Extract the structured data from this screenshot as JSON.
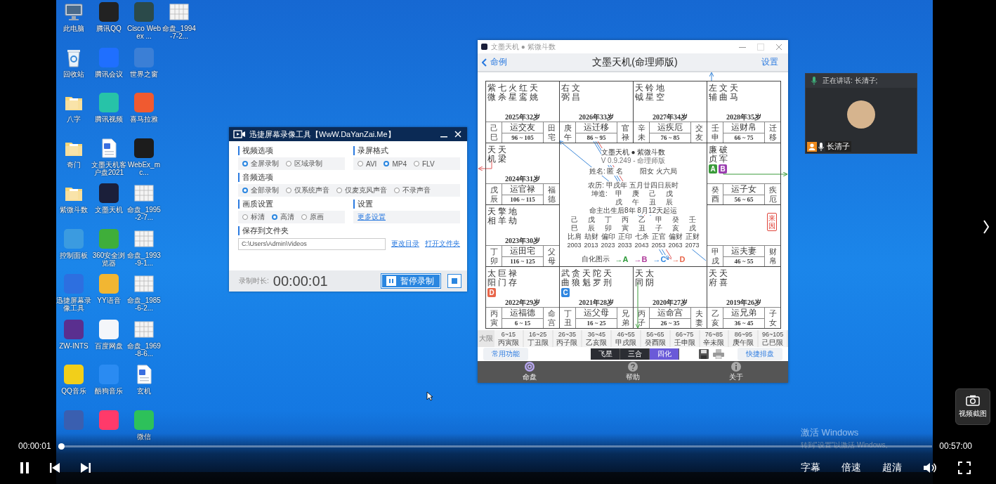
{
  "desktop": {
    "columns": [
      [
        {
          "label": "此电脑",
          "kind": "computer"
        },
        {
          "label": "回收站",
          "kind": "recycle"
        },
        {
          "label": "八字",
          "kind": "folder"
        },
        {
          "label": "奇门",
          "kind": "folder"
        },
        {
          "label": "紫微斗数",
          "kind": "folder"
        },
        {
          "label": "控制面板",
          "kind": "app",
          "color": "#3b9be0"
        },
        {
          "label": "迅捷屏幕录像工具",
          "kind": "app",
          "color": "#2d6fe0"
        },
        {
          "label": "ZW-INTS",
          "kind": "app",
          "color": "#5a2f8f"
        },
        {
          "label": "QQ音乐",
          "kind": "app",
          "color": "#f2cf1a"
        },
        {
          "kind": "app",
          "color": "#3a5fb0"
        }
      ],
      [
        {
          "label": "腾讯QQ",
          "kind": "app",
          "color": "#222222"
        },
        {
          "label": "腾讯会议",
          "kind": "app",
          "color": "#1f6fff"
        },
        {
          "label": "腾讯视频",
          "kind": "app",
          "color": "#27c3a8"
        },
        {
          "label": "文墨天机客户盘2021",
          "kind": "document"
        },
        {
          "label": "文墨天机",
          "kind": "app",
          "color": "#1b1f3a"
        },
        {
          "label": "360安全浏览器",
          "kind": "app",
          "color": "#3fae3a"
        },
        {
          "label": "YY语音",
          "kind": "app",
          "color": "#f2b632"
        },
        {
          "label": "百度网盘",
          "kind": "app",
          "color": "#f4f6fa"
        },
        {
          "label": "酷狗音乐",
          "kind": "app",
          "color": "#2a8bf2"
        },
        {
          "kind": "app",
          "color": "#ff3a6a"
        }
      ],
      [
        {
          "label": "Cisco Webex ...",
          "kind": "app",
          "color": "#2b4a4a"
        },
        {
          "label": "世界之窗",
          "kind": "app",
          "color": "#3b7fd6"
        },
        {
          "label": "喜马拉雅",
          "kind": "app",
          "color": "#f05a30"
        },
        {
          "label": "WebEx_mc...",
          "kind": "app",
          "color": "#1c1c1c"
        },
        {
          "label": "命盘_1995-2-7...",
          "kind": "image"
        },
        {
          "label": "命盘_1993-9-1...",
          "kind": "image"
        },
        {
          "label": "命盘_1985-6-2...",
          "kind": "image"
        },
        {
          "label": "命盘_1969-8-6...",
          "kind": "image"
        },
        {
          "label": "玄机",
          "kind": "document"
        },
        {
          "label": "微信",
          "kind": "app",
          "color": "#2dc15a"
        }
      ],
      [
        {
          "label": "命盘_1994-7-2...",
          "kind": "image"
        }
      ]
    ],
    "activation": {
      "title": "激活 Windows",
      "text": "转到\"设置\"以激活 Windows。"
    }
  },
  "recorder": {
    "title": "迅捷屏幕录像工具【WwW.DaYanZai.Me】",
    "groups": [
      {
        "label": "视频选项",
        "kind": "radio",
        "wide": false,
        "options": [
          {
            "label": "全屏录制",
            "selected": true
          },
          {
            "label": "区域录制",
            "selected": false
          }
        ]
      },
      {
        "label": "录屏格式",
        "kind": "radio",
        "wide": false,
        "options": [
          {
            "label": "AVI",
            "selected": false
          },
          {
            "label": "MP4",
            "selected": true
          },
          {
            "label": "FLV",
            "selected": false
          }
        ]
      },
      {
        "label": "音频选项",
        "kind": "radio",
        "wide": true,
        "options": [
          {
            "label": "全部录制",
            "selected": true
          },
          {
            "label": "仅系统声音",
            "selected": false
          },
          {
            "label": "仅麦克风声音",
            "selected": false
          },
          {
            "label": "不录声音",
            "selected": false
          }
        ]
      },
      {
        "label": "画质设置",
        "kind": "radio",
        "wide": false,
        "options": [
          {
            "label": "标清",
            "selected": false
          },
          {
            "label": "高清",
            "selected": true
          },
          {
            "label": "原画",
            "selected": false
          }
        ]
      },
      {
        "label": "设置",
        "kind": "link",
        "wide": false,
        "links": [
          "更多设置"
        ]
      },
      {
        "label": "保存到文件夹",
        "kind": "folder",
        "wide": true,
        "value": "C:\\Users\\Admin\\Videos",
        "links": [
          "更改目录",
          "打开文件夹"
        ]
      }
    ],
    "duration_label": "录制时长:",
    "duration": "00:00:01",
    "pause": "暂停录制"
  },
  "chart_app": {
    "window_title": "文墨天机 ● 紫微斗数",
    "back": "命例",
    "title": "文墨天机(命理师版)",
    "settings": "设置",
    "palaces": [
      {
        "stars": [
          "紫微",
          "七杀",
          "火星",
          "红鸾",
          "天姚"
        ],
        "year": "2025年32岁",
        "stem_branch": "己巳",
        "period": "运交友",
        "range": "96 ~ 105",
        "palace": "田宅"
      },
      {
        "stars": [
          "右弼",
          "文昌"
        ],
        "year": "2026年33岁",
        "stem_branch": "庚午",
        "period": "运迁移",
        "range": "86 ~ 95",
        "palace": "官禄"
      },
      {
        "stars": [
          "天钺",
          "铃星",
          "地空"
        ],
        "year": "2027年34岁",
        "stem_branch": "辛未",
        "period": "运疾厄",
        "range": "76 ~ 85",
        "palace": "交友"
      },
      {
        "stars": [
          "左辅",
          "文曲",
          "天马"
        ],
        "year": "2028年35岁",
        "stem_branch": "壬申",
        "period": "运财帛",
        "range": "66 ~ 75",
        "palace": "迁移"
      },
      {
        "stars": [
          "天机",
          "天梁"
        ],
        "year": "2024年31岁",
        "stem_branch": "戊辰",
        "period": "运官禄",
        "range": "106 ~ 115",
        "palace": "福德"
      },
      {
        "stars": [
          "廉贞",
          "破军"
        ],
        "badges": [
          {
            "label": "A",
            "color": "#3a9a3a"
          },
          {
            "label": "B",
            "color": "#9b3fb0"
          }
        ],
        "stem_branch": "癸酉",
        "period": "运子女",
        "range": "56 ~ 65",
        "palace": "疾厄"
      },
      {
        "stars": [
          "天相",
          "擎羊",
          "地劫"
        ],
        "year": "2023年30岁",
        "stem_branch": "丁卯",
        "period": "运田宅",
        "range": "116 ~ 125",
        "palace": "父母"
      },
      {
        "marker": "来因",
        "stem_branch": "甲戌",
        "period": "运夫妻",
        "range": "46 ~ 55",
        "palace": "财帛"
      },
      {
        "stars": [
          "太阳",
          "巨门",
          "禄存"
        ],
        "badges": [
          {
            "label": "D",
            "color": "#e8664a"
          }
        ],
        "year": "2022年29岁",
        "stem_branch": "丙寅",
        "period": "运福德",
        "range": "6 ~ 15",
        "palace": "命宫"
      },
      {
        "stars": [
          "武曲",
          "贪狼",
          "天魁",
          "陀罗",
          "天刑"
        ],
        "badges": [
          {
            "label": "C",
            "color": "#2f86e0"
          }
        ],
        "year": "2021年28岁",
        "stem_branch": "丁丑",
        "period": "运父母",
        "range": "16 ~ 25",
        "palace": "兄弟"
      },
      {
        "stars": [
          "天同",
          "太阴"
        ],
        "year": "2020年27岁",
        "stem_branch": "丙子",
        "period": "运命宫",
        "range": "26 ~ 35",
        "palace": "夫妻"
      },
      {
        "stars": [
          "天府",
          "天喜"
        ],
        "year": "2019年26岁",
        "stem_branch": "乙亥",
        "period": "运兄弟",
        "range": "36 ~ 45",
        "palace": "子女"
      }
    ],
    "center": {
      "title": "文墨天机 ● 紫微斗数",
      "version": "V 0.9.249 - 命理师版",
      "name": "姓名: 匿 名",
      "gender_bureau": "阳女 火六局",
      "lunar": "农历: 甲戌年 五月廿四日辰时",
      "pillars_label": "坤造:",
      "pillars_top": [
        "甲",
        "庚",
        "己",
        "戊"
      ],
      "pillars_bottom": [
        "戌",
        "午",
        "丑",
        "辰"
      ],
      "luck_start": "命主出生后8年 8月12天起运",
      "luck": [
        {
          "stem": "己",
          "branch": "巳",
          "god": "比肩",
          "year": "2003"
        },
        {
          "stem": "戊",
          "branch": "辰",
          "god": "劫财",
          "year": "2013"
        },
        {
          "stem": "丁",
          "branch": "卯",
          "god": "偏印",
          "year": "2023"
        },
        {
          "stem": "丙",
          "branch": "寅",
          "god": "正印",
          "year": "2033"
        },
        {
          "stem": "乙",
          "branch": "丑",
          "god": "七杀",
          "year": "2043"
        },
        {
          "stem": "甲",
          "branch": "子",
          "god": "正官",
          "year": "2053"
        },
        {
          "stem": "癸",
          "branch": "亥",
          "god": "偏财",
          "year": "2063"
        },
        {
          "stem": "壬",
          "branch": "戌",
          "god": "正财",
          "year": "2073"
        }
      ],
      "legend_label": "自化图示",
      "legend": [
        {
          "label": "→A",
          "color": "#2e9a3a"
        },
        {
          "label": "→B",
          "color": "#b03a9a"
        },
        {
          "label": "→C",
          "color": "#2f86e0"
        },
        {
          "label": "→D",
          "color": "#e8664a"
        }
      ]
    },
    "decades_label": "大限",
    "decades": [
      {
        "range": "6~15",
        "name": "丙寅限"
      },
      {
        "range": "16~25",
        "name": "丁丑限"
      },
      {
        "range": "26~35",
        "name": "丙子限"
      },
      {
        "range": "36~45",
        "name": "乙亥限"
      },
      {
        "range": "46~55",
        "name": "甲戌限"
      },
      {
        "range": "56~65",
        "name": "癸酉限"
      },
      {
        "range": "66~75",
        "name": "壬申限"
      },
      {
        "range": "76~85",
        "name": "辛未限"
      },
      {
        "range": "86~95",
        "name": "庚午限"
      },
      {
        "range": "96~105",
        "name": "己巳限"
      }
    ],
    "common": "常用功能",
    "modes": [
      {
        "label": "飞星",
        "selected": false
      },
      {
        "label": "三合",
        "selected": false
      },
      {
        "label": "四化",
        "selected": true
      }
    ],
    "quick": "快捷排盘",
    "nav": [
      {
        "label": "命盘",
        "kind": "chart",
        "selected": true
      },
      {
        "label": "帮助",
        "kind": "help",
        "selected": false
      },
      {
        "label": "关于",
        "kind": "about",
        "selected": false
      }
    ]
  },
  "video_call": {
    "speaking": "正在讲话: 长清子;",
    "name": "长清子"
  },
  "player": {
    "time_current": "00:00:01",
    "time_total": "00:57:00",
    "progress": {
      "level": 0.0003
    },
    "options": [
      "字幕",
      "倍速",
      "超清"
    ],
    "screenshot": "视频截图"
  }
}
